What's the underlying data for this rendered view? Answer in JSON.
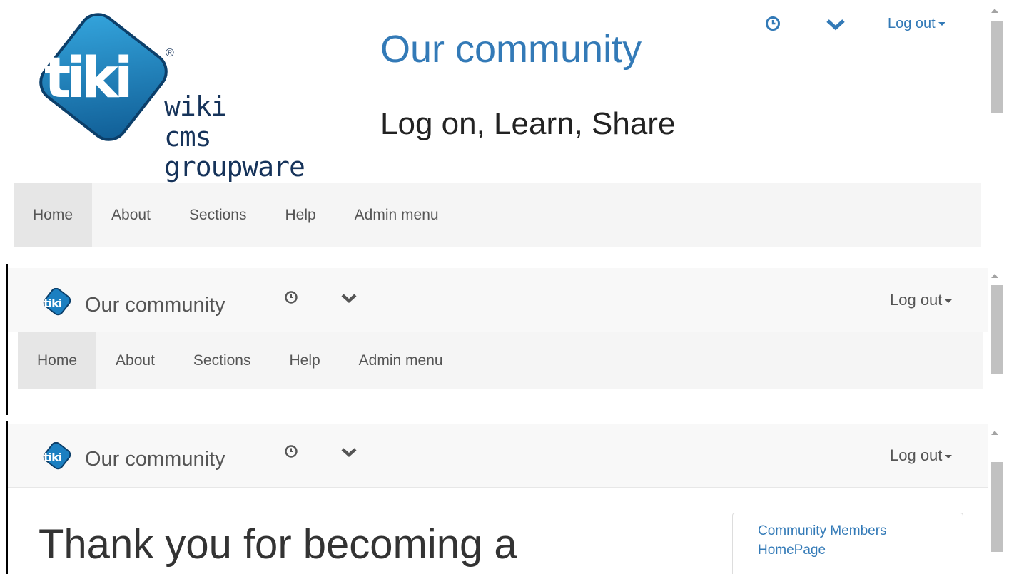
{
  "header": {
    "site_title": "Our community",
    "site_subtitle": "Log on, Learn, Share",
    "logo_word": "tiki",
    "logo_registered": "®",
    "logo_lines": [
      "wiki",
      "cms",
      "groupware"
    ]
  },
  "topbar": {
    "logout_label": "Log out",
    "recent_icon": "clock-icon",
    "menu_icon": "chevron-down-icon"
  },
  "nav": {
    "items": [
      {
        "label": "Home",
        "active": true
      },
      {
        "label": "About",
        "active": false
      },
      {
        "label": "Sections",
        "active": false
      },
      {
        "label": "Help",
        "active": false
      },
      {
        "label": "Admin menu",
        "active": false
      }
    ]
  },
  "fixed_navbar": {
    "brand_label": "Our community",
    "logo_word": "tiki"
  },
  "content": {
    "heading": "Thank you for becoming a",
    "side_links": [
      "Community Members",
      "HomePage"
    ]
  },
  "colors": {
    "accent": "#337ab7",
    "logo_blue": "#1b7fc1",
    "logo_dark": "#16335a"
  }
}
